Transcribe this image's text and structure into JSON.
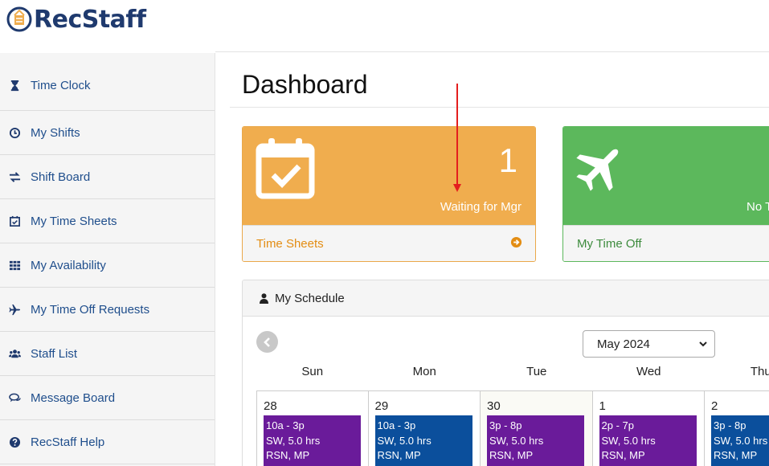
{
  "brand": {
    "name": "RecStaff"
  },
  "sidebar": {
    "items": [
      {
        "label": "Time Clock",
        "icon": "hourglass-icon"
      },
      {
        "label": "My Shifts",
        "icon": "clock-icon"
      },
      {
        "label": "Shift Board",
        "icon": "exchange-icon"
      },
      {
        "label": "My Time Sheets",
        "icon": "calendar-check-icon"
      },
      {
        "label": "My Availability",
        "icon": "grid-icon"
      },
      {
        "label": "My Time Off Requests",
        "icon": "plane-icon"
      },
      {
        "label": "Staff List",
        "icon": "users-icon"
      },
      {
        "label": "Message Board",
        "icon": "comments-icon"
      },
      {
        "label": "RecStaff Help",
        "icon": "question-circle-icon"
      }
    ]
  },
  "main": {
    "title": "Dashboard",
    "timesheets_panel": {
      "count": "1",
      "status": "Waiting for Mgr",
      "link": "Time Sheets",
      "color": "#f0ad4e"
    },
    "timeoff_panel": {
      "status": "No T",
      "link": "My Time Off",
      "color": "#5cb85c"
    },
    "schedule": {
      "heading": "My Schedule",
      "month": "May 2024",
      "days_of_week": [
        "Sun",
        "Mon",
        "Tue",
        "Wed",
        "Thu"
      ],
      "days": [
        {
          "num": "28",
          "shift": {
            "time": "10a - 3p",
            "hours": "SW, 5.0 hrs",
            "staff": "RSN, MP",
            "color": "purple"
          }
        },
        {
          "num": "29",
          "shift": {
            "time": "10a - 3p",
            "hours": "SW, 5.0 hrs",
            "staff": "RSN, MP",
            "color": "blue"
          }
        },
        {
          "num": "30",
          "shift": {
            "time": "3p - 8p",
            "hours": "SW, 5.0 hrs",
            "staff": "RSN, MP",
            "color": "purple"
          }
        },
        {
          "num": "1",
          "shift": {
            "time": "2p - 7p",
            "hours": "SW, 5.0 hrs",
            "staff": "RSN, MP",
            "color": "purple"
          }
        },
        {
          "num": "2",
          "shift": {
            "time": "3p - 8p",
            "hours": "SW, 5.0 hrs",
            "staff": "RSN, MP",
            "color": "blue"
          }
        }
      ]
    }
  }
}
